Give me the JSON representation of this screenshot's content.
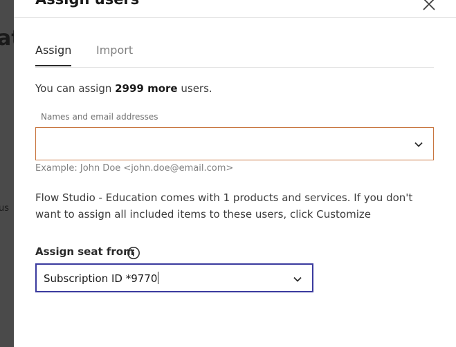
{
  "backdrop": {
    "fragment_heading": "at",
    "fragment_text": "us"
  },
  "dialog": {
    "title": "Assign users",
    "close_icon": "close-icon",
    "tabs": [
      {
        "label": "Assign",
        "active": true
      },
      {
        "label": "Import",
        "active": false
      }
    ],
    "info": {
      "prefix": "You can assign ",
      "count": "2999 more",
      "suffix": " users."
    },
    "names_field": {
      "label": "Names and email addresses",
      "value": "",
      "icon": "chevron-down-icon",
      "example": "Example: John Doe <john.doe@email.com>"
    },
    "description": "Flow Studio - Education comes with 1 products and services. If you don't want to assign all included items to these users, click Customize",
    "seat": {
      "label": "Assign seat from",
      "info_icon": "info-icon",
      "value": "Subscription ID *9770",
      "icon": "chevron-down-icon"
    }
  },
  "colors": {
    "accent_border": "#c8753f",
    "focus_border": "#3a3a9e",
    "backdrop": "#4a4a4a"
  }
}
